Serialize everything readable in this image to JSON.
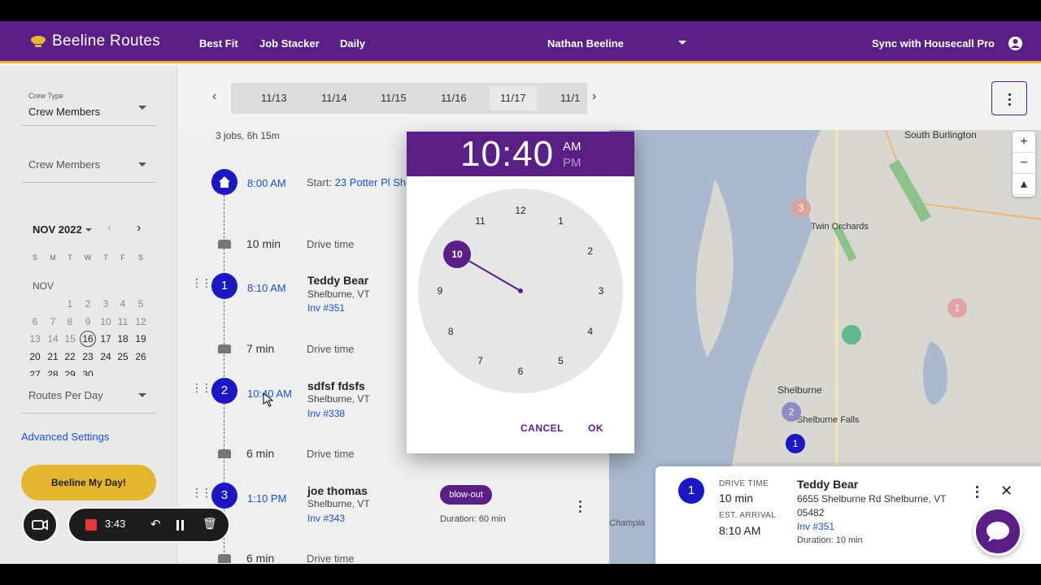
{
  "app": {
    "title": "Beeline Routes"
  },
  "nav": {
    "items": [
      "Best Fit",
      "Job Stacker",
      "Daily"
    ],
    "crew_member": "Nathan Beeline",
    "sync_label": "Sync with Housecall Pro"
  },
  "sidebar": {
    "crew_type_label": "Crew Type",
    "crew_type_value": "Crew Members",
    "crew_members_value": "Crew Members",
    "calendar_month": "NOV 2022",
    "weekdays": [
      "S",
      "M",
      "T",
      "W",
      "T",
      "F",
      "S"
    ],
    "month_short": "NOV",
    "routes_per_day": "Routes Per Day",
    "advanced_settings": "Advanced Settings",
    "beeline_button": "Beeline My Day!"
  },
  "date_strip": {
    "dates": [
      "11/13",
      "11/14",
      "11/15",
      "11/16",
      "11/17",
      "11/1"
    ],
    "selected": "11/17"
  },
  "route": {
    "summary": "3 jobs, 6h 15m",
    "start_time": "8:00 AM",
    "start_prefix": "Start:",
    "start_addr": "23 Potter Pl Sh",
    "drive_label": "Drive time",
    "drives": [
      "10 min",
      "7 min",
      "6 min",
      "6 min"
    ],
    "stops": [
      {
        "num": "1",
        "time": "8:10 AM",
        "name": "Teddy Bear",
        "city": "Shelburne, VT",
        "inv": "Inv #351"
      },
      {
        "num": "2",
        "time": "10:40 AM",
        "name": "sdfsf fdsfs",
        "city": "Shelburne, VT",
        "inv": "Inv #338"
      },
      {
        "num": "3",
        "time": "1:10 PM",
        "name": "joe thomas",
        "city": "Shelburne, VT",
        "inv": "Inv #343"
      }
    ],
    "tag": "blow-out",
    "tag_duration_label": "Duration:",
    "tag_duration": "60 min"
  },
  "time_picker": {
    "time": "10:40",
    "am": "AM",
    "pm": "PM",
    "numbers": [
      "12",
      "1",
      "2",
      "3",
      "4",
      "5",
      "6",
      "7",
      "8",
      "9",
      "10",
      "11"
    ],
    "selected_hour": "10",
    "cancel": "CANCEL",
    "ok": "OK"
  },
  "card": {
    "num": "1",
    "drive_time_label": "DRIVE TIME",
    "drive_time": "10 min",
    "arrival_label": "EST. ARRIVAL",
    "arrival": "8:10 AM",
    "name": "Teddy Bear",
    "address": "6655 Shelburne Rd Shelburne, VT 05482",
    "inv": "Inv #351",
    "duration_label": "Duration:",
    "duration": "10 min"
  },
  "map": {
    "labels": [
      "South Burlington",
      "Twin Orchards",
      "Shelburne",
      "Shelburne Falls",
      "Champla"
    ],
    "zoom_in": "+",
    "zoom_out": "−"
  },
  "recorder": {
    "time": "3:43"
  },
  "colors": {
    "brand": "#5a1f86",
    "accent": "#e8b831",
    "stop": "#1a17c4",
    "link": "#1a4fd6"
  }
}
